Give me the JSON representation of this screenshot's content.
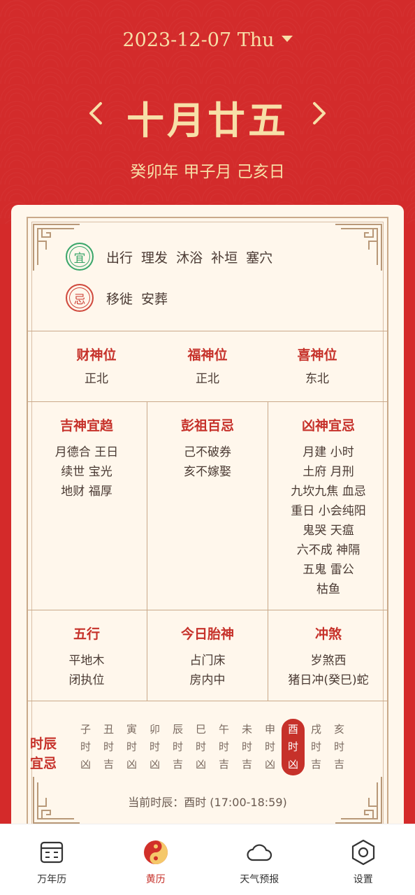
{
  "header": {
    "date": "2023-12-07 Thu",
    "lunar_date": "十月廿五",
    "ganzhi": "癸卯年 甲子月 己亥日"
  },
  "yiji": {
    "yi_seal": "宜",
    "yi_items": "出行 理发 沐浴 补垣 塞穴",
    "ji_seal": "忌",
    "ji_items": "移徙 安葬"
  },
  "directions": [
    {
      "title": "财神位",
      "value": "正北"
    },
    {
      "title": "福神位",
      "value": "正北"
    },
    {
      "title": "喜神位",
      "value": "东北"
    }
  ],
  "gods": {
    "ji_shen": {
      "title": "吉神宜趋",
      "lines": [
        "月德合 王日",
        "续世 宝光",
        "地财 福厚"
      ]
    },
    "peng_zu": {
      "title": "彭祖百忌",
      "lines": [
        "己不破券",
        "亥不嫁娶"
      ]
    },
    "xiong_shen": {
      "title": "凶神宜忌",
      "lines": [
        "月建 小时",
        "土府 月刑",
        "九坎九焦 血忌",
        "重日 小会纯阳",
        "鬼哭 天瘟",
        "六不成 神隔",
        "五鬼 雷公",
        "枯鱼"
      ]
    }
  },
  "misc": {
    "wuxing": {
      "title": "五行",
      "lines": [
        "平地木",
        "闭执位"
      ]
    },
    "taishen": {
      "title": "今日胎神",
      "lines": [
        "占门床",
        "房内中"
      ]
    },
    "chongsha": {
      "title": "冲煞",
      "lines": [
        "岁煞西",
        "猪日冲(癸巳)蛇"
      ]
    }
  },
  "shichen": {
    "label_line1": "时辰",
    "label_line2": "宜忌",
    "hours": [
      {
        "branch": "子",
        "suffix": "时",
        "luck": "凶"
      },
      {
        "branch": "丑",
        "suffix": "时",
        "luck": "吉"
      },
      {
        "branch": "寅",
        "suffix": "时",
        "luck": "凶"
      },
      {
        "branch": "卯",
        "suffix": "时",
        "luck": "凶"
      },
      {
        "branch": "辰",
        "suffix": "时",
        "luck": "吉"
      },
      {
        "branch": "巳",
        "suffix": "时",
        "luck": "凶"
      },
      {
        "branch": "午",
        "suffix": "时",
        "luck": "吉"
      },
      {
        "branch": "未",
        "suffix": "时",
        "luck": "吉"
      },
      {
        "branch": "申",
        "suffix": "时",
        "luck": "凶"
      },
      {
        "branch": "酉",
        "suffix": "时",
        "luck": "凶"
      },
      {
        "branch": "戌",
        "suffix": "时",
        "luck": "吉"
      },
      {
        "branch": "亥",
        "suffix": "时",
        "luck": "吉"
      }
    ],
    "active_index": 9,
    "current": "当前时辰：酉时 (17:00-18:59)"
  },
  "tabs": [
    {
      "label": "万年历",
      "icon": "calendar-icon"
    },
    {
      "label": "黄历",
      "icon": "yin-yang-icon"
    },
    {
      "label": "天气预报",
      "icon": "cloud-icon"
    },
    {
      "label": "设置",
      "icon": "settings-icon"
    }
  ],
  "colors": {
    "header_red": "#d32b2b",
    "gold": "#f7dfa8",
    "accent_red": "#c6312a",
    "card_bg": "#fff7ec",
    "yi_green": "#3aa66a"
  }
}
